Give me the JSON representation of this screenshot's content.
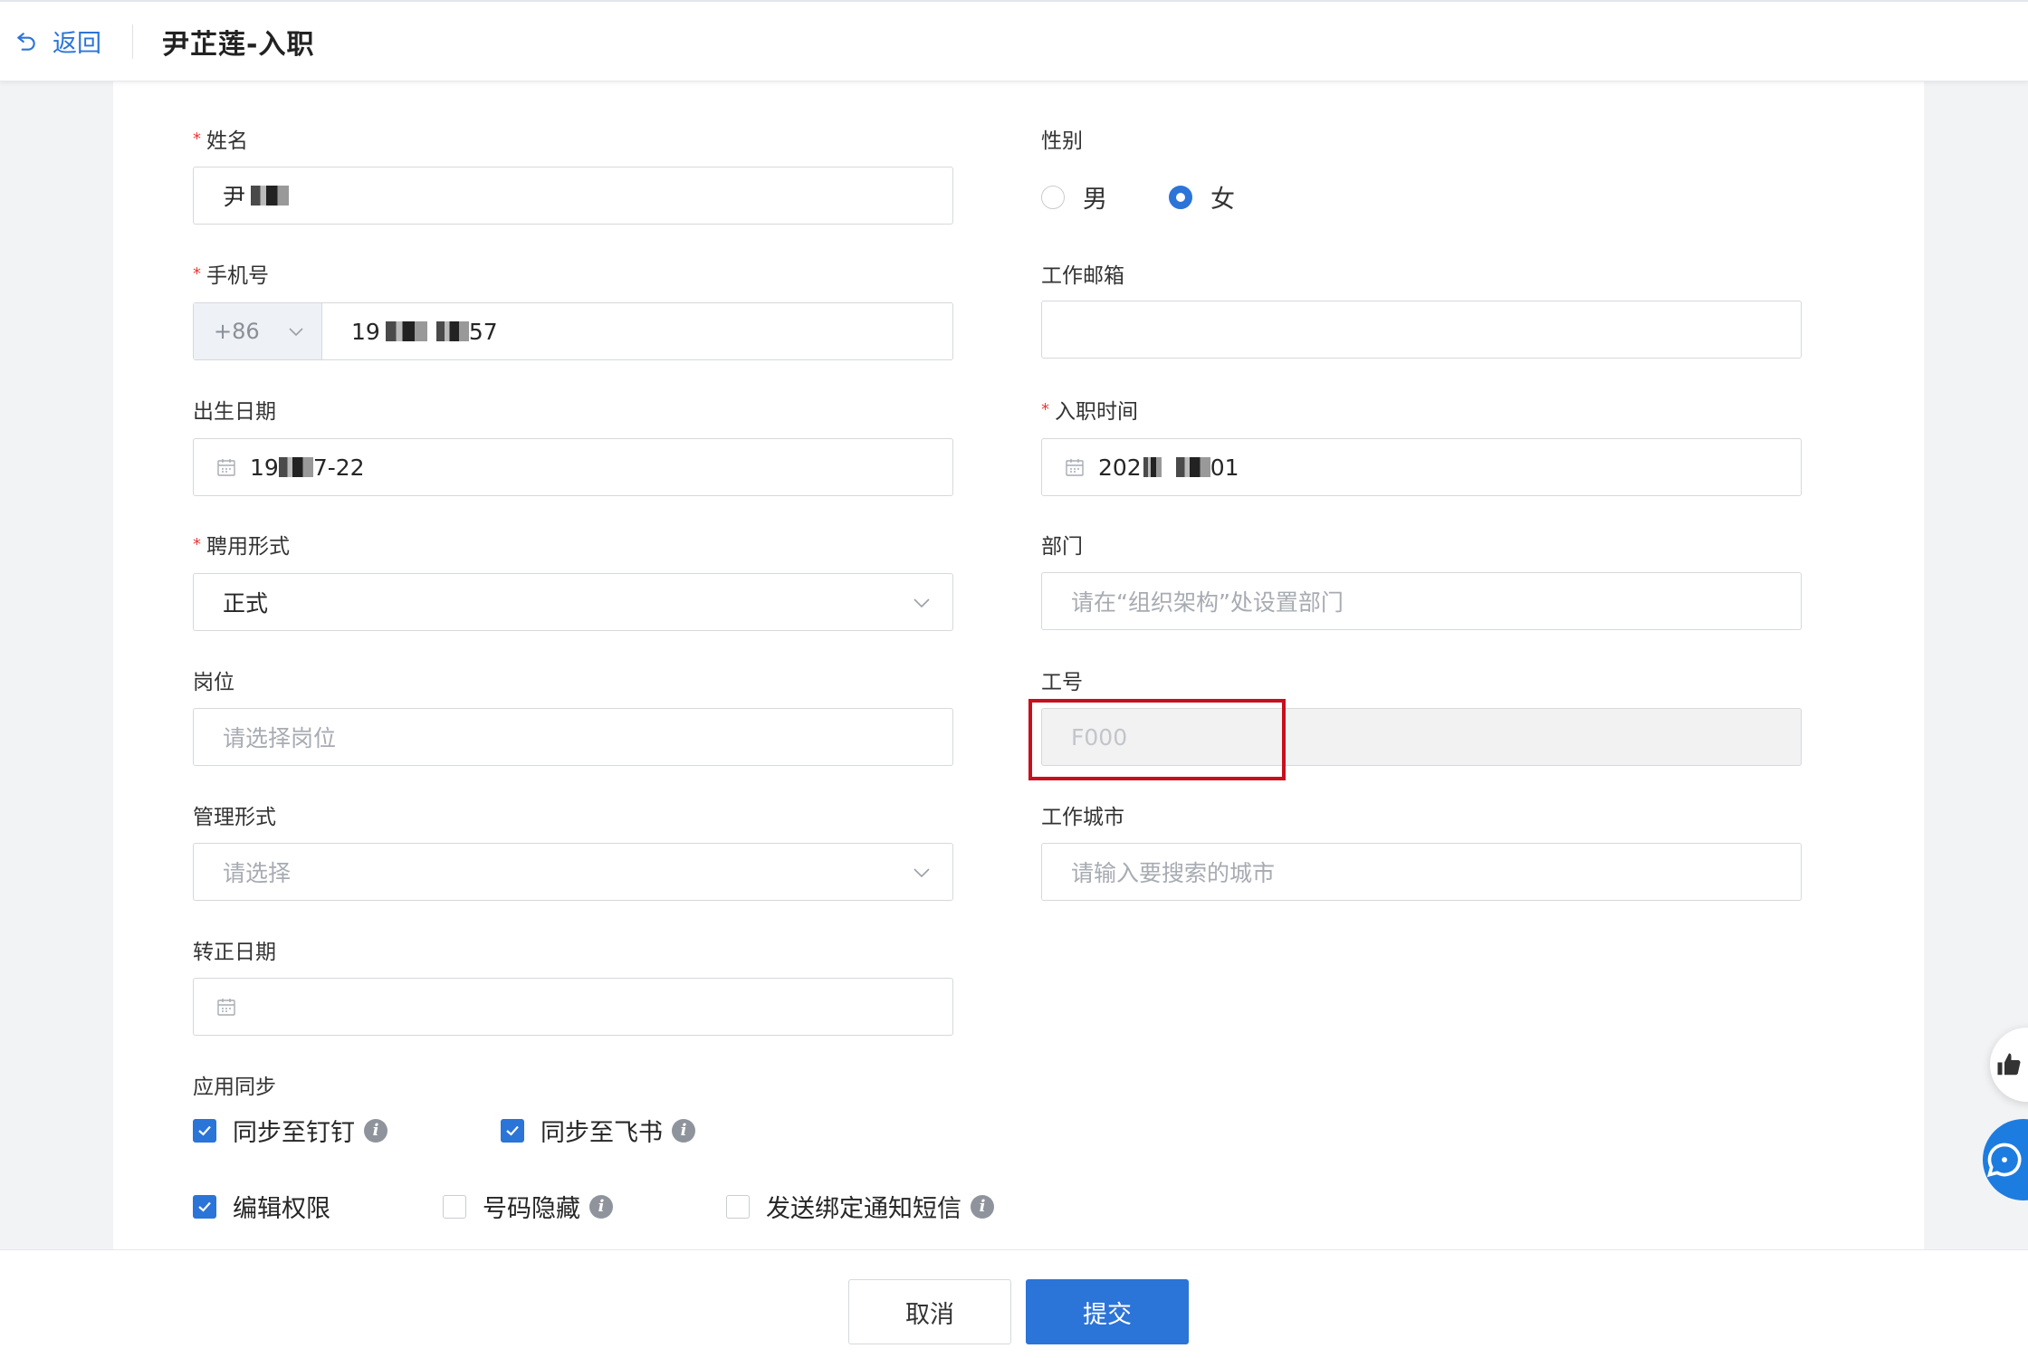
{
  "header": {
    "back_label": "返回",
    "title": "尹芷莲-入职"
  },
  "form": {
    "name": {
      "label": "姓名",
      "required": true,
      "value_prefix": "尹"
    },
    "gender": {
      "label": "性别",
      "options": [
        "男",
        "女"
      ],
      "selected": "女"
    },
    "phone": {
      "label": "手机号",
      "required": true,
      "country_code": "+86",
      "value_start": "19",
      "value_end": "57"
    },
    "work_email": {
      "label": "工作邮箱",
      "value": ""
    },
    "birth_date": {
      "label": "出生日期",
      "value_start": "19",
      "value_end": "7-22"
    },
    "hire_date": {
      "label": "入职时间",
      "required": true,
      "value_start": "202",
      "value_end": "01"
    },
    "employment_type": {
      "label": "聘用形式",
      "required": true,
      "value": "正式"
    },
    "department": {
      "label": "部门",
      "placeholder": "请在“组织架构”处设置部门"
    },
    "position": {
      "label": "岗位",
      "placeholder": "请选择岗位"
    },
    "employee_id": {
      "label": "工号",
      "value": "F000",
      "disabled": true
    },
    "management_type": {
      "label": "管理形式",
      "placeholder": "请选择"
    },
    "work_city": {
      "label": "工作城市",
      "placeholder": "请输入要搜索的城市"
    },
    "regularization_date": {
      "label": "转正日期",
      "value": ""
    },
    "app_sync": {
      "label": "应用同步",
      "dingtalk": {
        "label": "同步至钉钉",
        "checked": true
      },
      "feishu": {
        "label": "同步至飞书",
        "checked": true
      }
    },
    "edit_permission": {
      "label": "编辑权限",
      "checked": true
    },
    "hide_number": {
      "label": "号码隐藏",
      "checked": false
    },
    "send_sms": {
      "label": "发送绑定通知短信",
      "checked": false
    }
  },
  "footer": {
    "cancel_label": "取消",
    "submit_label": "提交"
  },
  "colors": {
    "accent": "#2b74d8",
    "highlight_border": "#c8101d",
    "required": "#e53935"
  }
}
